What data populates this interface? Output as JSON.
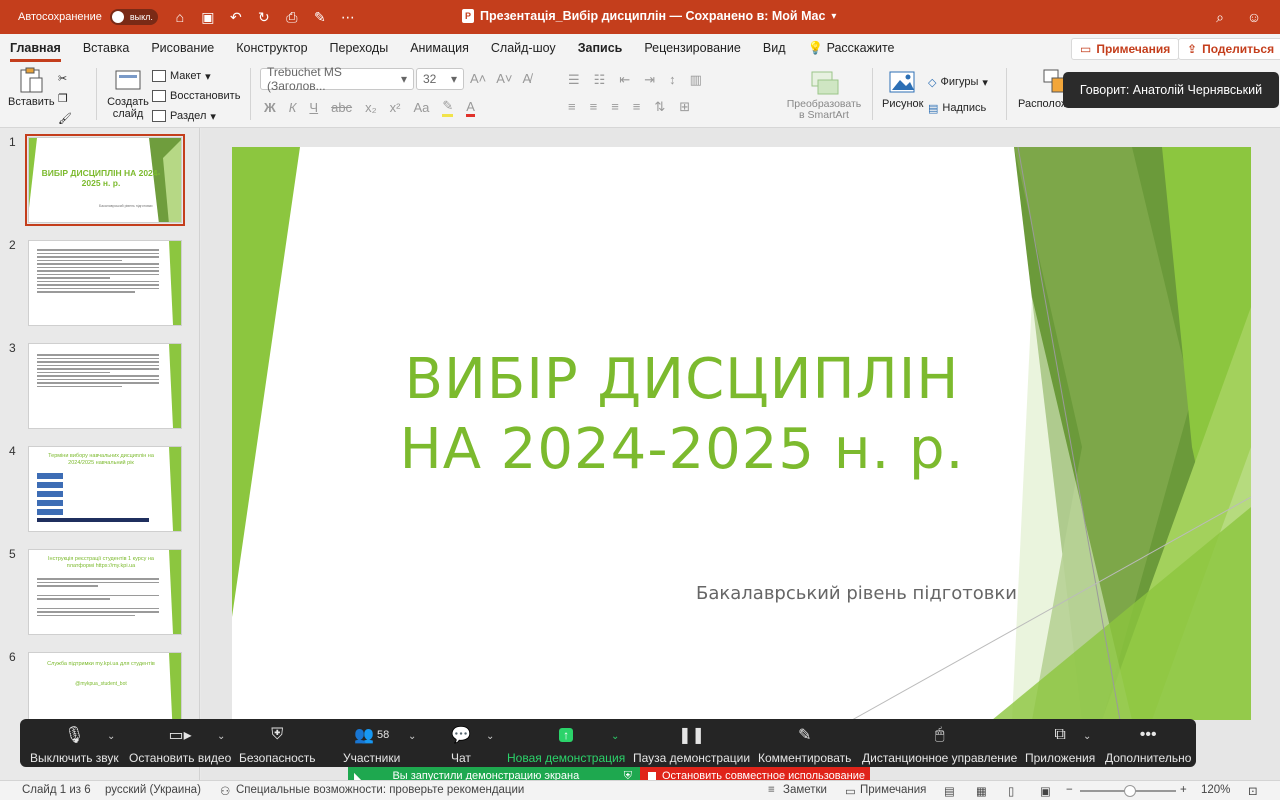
{
  "titlebar": {
    "autosave_label": "Автосохранение",
    "autosave_state": "выкл.",
    "doc_title": "Презентація_Вибір дисциплін — Сохранено в: Мой Mac",
    "icons": [
      "home-icon",
      "save-icon",
      "undo-icon",
      "redo-icon",
      "print-icon",
      "edit-icon",
      "more-icon"
    ]
  },
  "tabs": [
    {
      "label": "Главная",
      "active": true
    },
    {
      "label": "Вставка"
    },
    {
      "label": "Рисование"
    },
    {
      "label": "Конструктор"
    },
    {
      "label": "Переходы"
    },
    {
      "label": "Анимация"
    },
    {
      "label": "Слайд-шоу"
    },
    {
      "label": "Запись"
    },
    {
      "label": "Рецензирование"
    },
    {
      "label": "Вид"
    },
    {
      "label": "Расскажите"
    }
  ],
  "tab_buttons": {
    "comments": "Примечания",
    "share": "Поделиться"
  },
  "ribbon": {
    "paste": "Вставить",
    "new_slide": "Создать слайд",
    "layout": "Макет",
    "reset": "Восстановить",
    "section": "Раздел",
    "font_name": "Trebuchet MS (Заголов...",
    "font_size": "32",
    "smartart": "Преобразовать в SmartArt",
    "picture": "Рисунок",
    "shapes": "Фигуры",
    "textbox": "Надпись",
    "arrange": "Расположение"
  },
  "speaker_tooltip": "Говорит: Анатолій Чернявський",
  "thumbnails": [
    {
      "num": "1",
      "title": "ВИБІР ДИСЦИПЛІН НА 2024-2025 н. р.",
      "sub": "Бакалаврський рівень підготовки"
    },
    {
      "num": "2"
    },
    {
      "num": "3"
    },
    {
      "num": "4",
      "title": "Терміни вибору навчальних дисциплін на 2024/2025 навчальний рік"
    },
    {
      "num": "5",
      "title": "Інструкція реєстрації студентів 1 курсу на платформі https://my.kpi.ua"
    },
    {
      "num": "6",
      "title": "Служба підтримки my.kpi.ua для студентів",
      "sub": "@mykpua_student_bot"
    }
  ],
  "slide": {
    "title_line1": "ВИБІР ДИСЦИПЛІН",
    "title_line2": "НА 2024-2025 н. р.",
    "subtitle": "Бакалаврський рівень підготовки"
  },
  "zoom_toolbar": {
    "mute": "Выключить звук",
    "video": "Остановить видео",
    "security": "Безопасность",
    "participants": "Участники",
    "participants_count": "58",
    "chat": "Чат",
    "new_share": "Новая демонстрация",
    "pause": "Пауза демонстрации",
    "annotate": "Комментировать",
    "remote": "Дистанционное управление",
    "apps": "Приложения",
    "more": "Дополнительно"
  },
  "share_banner": "Вы запустили демонстрацию экрана",
  "stop_banner": "Остановить совместное использование",
  "status": {
    "slide": "Слайд 1 из 6",
    "language": "русский (Украина)",
    "accessibility": "Специальные возможности: проверьте рекомендации",
    "notes": "Заметки",
    "comments": "Примечания",
    "zoom": "120%"
  },
  "colors": {
    "accent": "#c43e1c",
    "title_green": "#7cba2e",
    "zoom_green": "#2bd36a"
  }
}
